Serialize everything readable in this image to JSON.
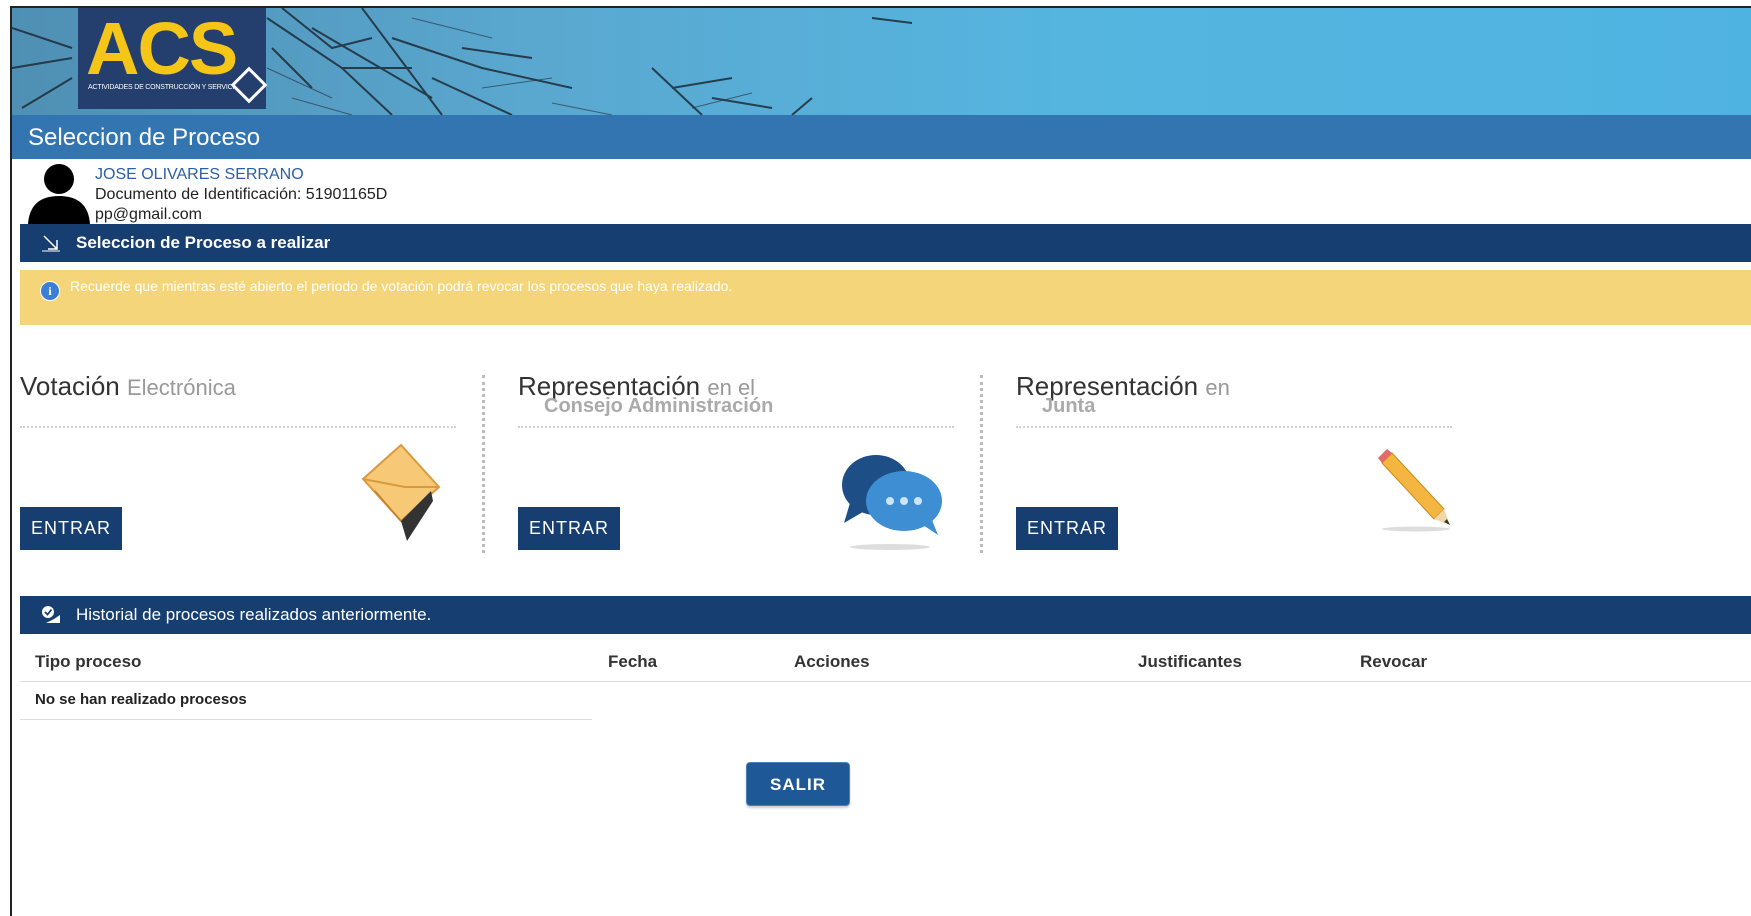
{
  "header": {
    "logo_text": "ACS",
    "logo_subtitle": "ACTIVIDADES DE CONSTRUCCIÓN Y SERVICIOS",
    "page_title": "Seleccion de Proceso"
  },
  "user": {
    "name": "JOSE OLIVARES SERRANO",
    "document": "Documento de Identificación: 51901165D",
    "email": "pp@gmail.com"
  },
  "selection_bar": {
    "label": "Seleccion de Proceso a realizar"
  },
  "notice": {
    "icon": "info-icon",
    "text": "Recuerde que mientras esté abierto el periodo de votación podrá revocar los procesos que haya realizado."
  },
  "cards": [
    {
      "title_main": "Votación",
      "title_light": "Electrónica",
      "title_sub": "",
      "button_label": "ENTRAR",
      "icon": "envelope-icon"
    },
    {
      "title_main": "Representación",
      "title_light": "en el",
      "title_sub": "Consejo Administración",
      "button_label": "ENTRAR",
      "icon": "chat-bubbles-icon"
    },
    {
      "title_main": "Representación",
      "title_light": "en",
      "title_sub": "Junta",
      "button_label": "ENTRAR",
      "icon": "pencil-icon"
    }
  ],
  "history": {
    "label": "Historial de procesos realizados anteriormente.",
    "columns": [
      "Tipo proceso",
      "Fecha",
      "Acciones",
      "Justificantes",
      "Revocar"
    ],
    "empty_text": "No se han realizado procesos"
  },
  "exit_button": "SALIR",
  "colors": {
    "title_bar": "#3375b1",
    "section_bar": "#163e71",
    "notice_bg": "#f5d57a",
    "logo_bg": "#243e6e",
    "logo_text": "#f5c518"
  }
}
